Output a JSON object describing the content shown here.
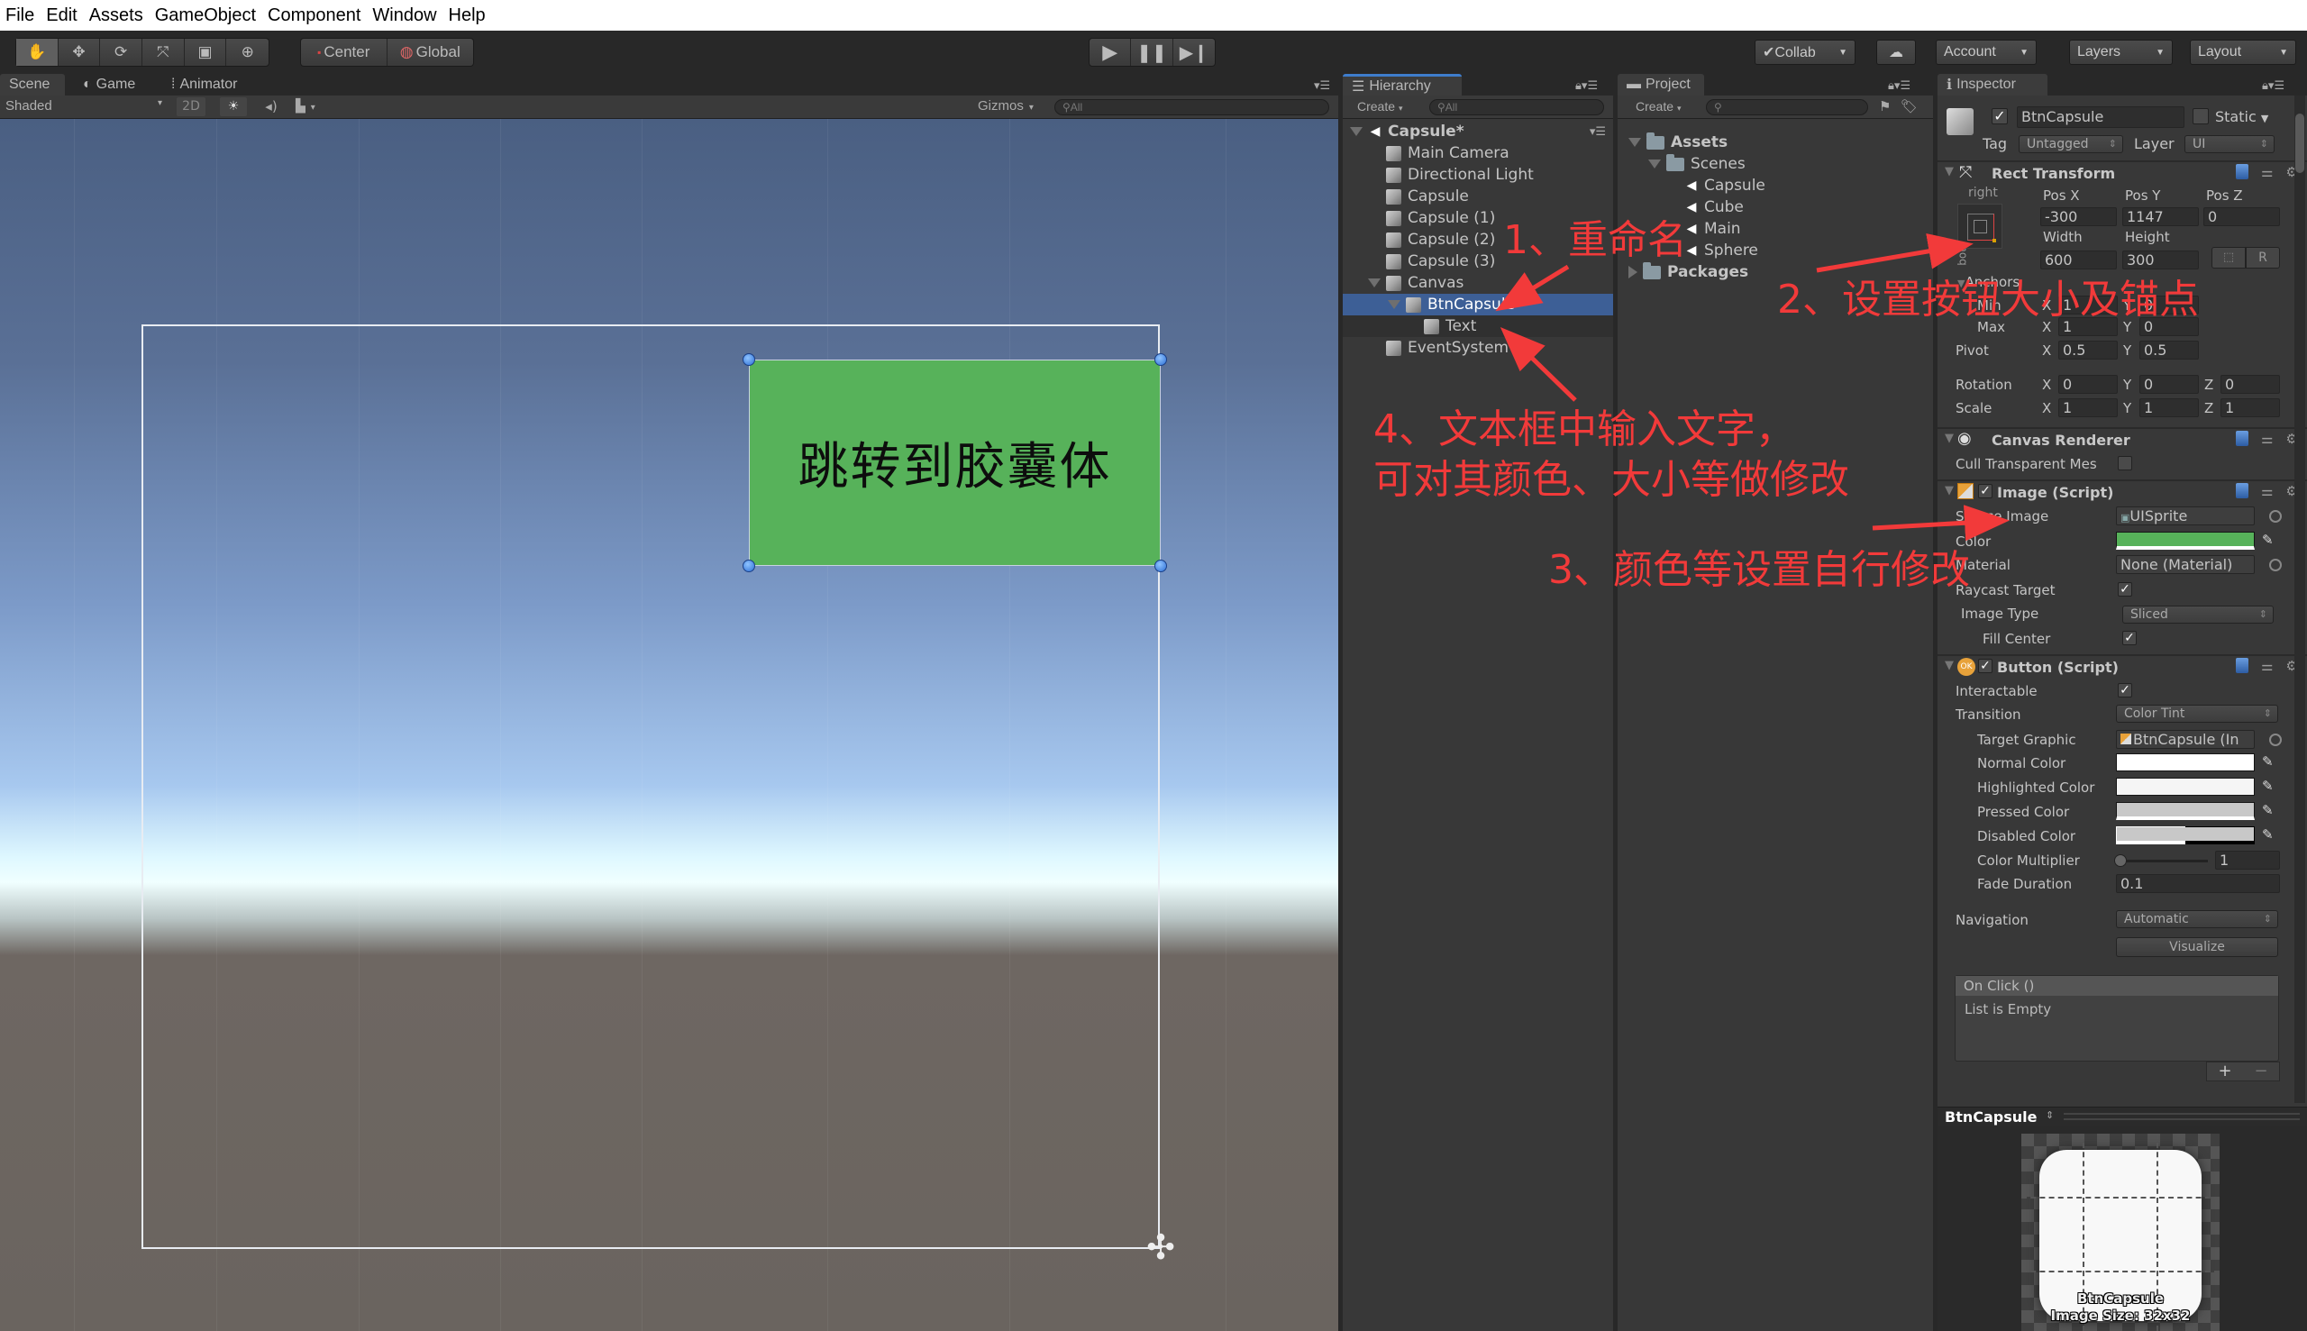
{
  "menubar": {
    "items": [
      "File",
      "Edit",
      "Assets",
      "GameObject",
      "Component",
      "Window",
      "Help"
    ]
  },
  "toolbar": {
    "tools": [
      "hand-tool",
      "move-tool",
      "rotate-tool",
      "scale-tool",
      "rect-tool",
      "transform-tool"
    ],
    "pivot_label": "Center",
    "space_label": "Global",
    "collab_label": "Collab",
    "account_label": "Account",
    "layers_label": "Layers",
    "layout_label": "Layout"
  },
  "scene_tabs": {
    "tabs": [
      "Scene",
      "Game",
      "Animator"
    ],
    "active": "Scene"
  },
  "scene_toolbar": {
    "shading": "Shaded",
    "mode_2d": "2D",
    "gizmos_label": "Gizmos",
    "search_placeholder": "All"
  },
  "scene": {
    "button_text": "跳转到胶囊体",
    "button_color": "#57b25a"
  },
  "hierarchy": {
    "tab_label": "Hierarchy",
    "create_label": "Create",
    "search_placeholder": "All",
    "scene_name": "Capsule*",
    "items": [
      {
        "label": "Main Camera",
        "depth": 1
      },
      {
        "label": "Directional Light",
        "depth": 1
      },
      {
        "label": "Capsule",
        "depth": 1
      },
      {
        "label": "Capsule (1)",
        "depth": 1
      },
      {
        "label": "Capsule (2)",
        "depth": 1
      },
      {
        "label": "Capsule (3)",
        "depth": 1
      },
      {
        "label": "Canvas",
        "depth": 1,
        "expanded": true
      },
      {
        "label": "BtnCapsule",
        "depth": 2,
        "expanded": true,
        "selected": true
      },
      {
        "label": "Text",
        "depth": 3
      },
      {
        "label": "EventSystem",
        "depth": 1
      }
    ]
  },
  "project": {
    "tab_label": "Project",
    "create_label": "Create",
    "tree": [
      {
        "label": "Assets",
        "type": "folder",
        "bold": true
      },
      {
        "label": "Scenes",
        "type": "folder"
      },
      {
        "label": "Capsule",
        "type": "scene"
      },
      {
        "label": "Cube",
        "type": "scene"
      },
      {
        "label": "Main",
        "type": "scene"
      },
      {
        "label": "Sphere",
        "type": "scene"
      },
      {
        "label": "Packages",
        "type": "folder",
        "bold": true
      }
    ]
  },
  "inspector": {
    "tab_label": "Inspector",
    "object_name": "BtnCapsule",
    "active": true,
    "static_label": "Static",
    "tag_label": "Tag",
    "tag_value": "Untagged",
    "layer_label": "Layer",
    "layer_value": "UI",
    "rect_transform": {
      "title": "Rect Transform",
      "anchor_h": "right",
      "anchor_v": "bottom",
      "pos_x_label": "Pos X",
      "pos_y_label": "Pos Y",
      "pos_z_label": "Pos Z",
      "pos_x": "-300",
      "pos_y": "1147",
      "pos_z": "0",
      "width_label": "Width",
      "height_label": "Height",
      "width": "600",
      "height": "300",
      "r_button": "R",
      "anchors_label": "Anchors",
      "min_label": "Min",
      "max_label": "Max",
      "min_x": "1",
      "min_y": "0",
      "max_x": "1",
      "max_y": "0",
      "pivot_label": "Pivot",
      "pivot_x": "0.5",
      "pivot_y": "0.5",
      "rotation_label": "Rotation",
      "rot_x": "0",
      "rot_y": "0",
      "rot_z": "0",
      "scale_label": "Scale",
      "scale_x": "1",
      "scale_y": "1",
      "scale_z": "1"
    },
    "canvas_renderer": {
      "title": "Canvas Renderer",
      "cull_label": "Cull Transparent Mes",
      "cull": false
    },
    "image": {
      "title": "Image (Script)",
      "source_image_label": "Source Image",
      "source_image": "UISprite",
      "color_label": "Color",
      "color": "#57b25a",
      "material_label": "Material",
      "material": "None (Material)",
      "raycast_label": "Raycast Target",
      "raycast": true,
      "image_type_label": "Image Type",
      "image_type": "Sliced",
      "fill_center_label": "Fill Center",
      "fill_center": true
    },
    "button": {
      "title": "Button (Script)",
      "interactable_label": "Interactable",
      "interactable": true,
      "transition_label": "Transition",
      "transition": "Color Tint",
      "target_graphic_label": "Target Graphic",
      "target_graphic": "BtnCapsule (In",
      "normal_color_label": "Normal Color",
      "normal_color": "#ffffff",
      "highlighted_color_label": "Highlighted Color",
      "highlighted_color": "#f5f5f5",
      "pressed_color_label": "Pressed Color",
      "pressed_color": "#c8c8c8",
      "disabled_color_label": "Disabled Color",
      "disabled_color": "#c8c8c8",
      "color_multiplier_label": "Color Multiplier",
      "color_multiplier": "1",
      "fade_duration_label": "Fade Duration",
      "fade_duration": "0.1",
      "navigation_label": "Navigation",
      "navigation": "Automatic",
      "visualize_label": "Visualize",
      "onclick_label": "On Click ()",
      "onclick_empty": "List is Empty",
      "add_label": "+",
      "remove_label": "−"
    },
    "preview": {
      "title": "BtnCapsule",
      "caption_name": "BtnCapsule",
      "caption_size": "Image Size: 32x32"
    }
  },
  "annotations": {
    "step1": "1、重命名",
    "step2": "2、设置按钮大小及锚点",
    "step3": "3、颜色等设置自行修改",
    "step4_line1": "4、文本框中输入文字，",
    "step4_line2": "可对其颜色、大小等做修改",
    "color": "#f23a3a"
  }
}
